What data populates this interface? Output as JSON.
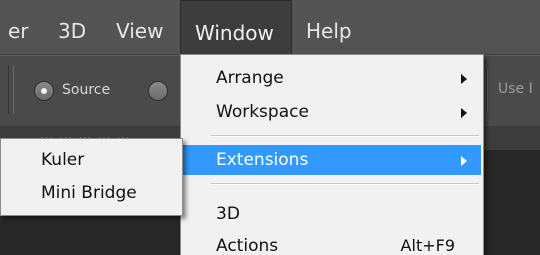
{
  "menubar": {
    "items": [
      {
        "id": "filter",
        "label": "er"
      },
      {
        "id": "3d",
        "label": "3D"
      },
      {
        "id": "view",
        "label": "View"
      },
      {
        "id": "window",
        "label": "Window",
        "active": true
      },
      {
        "id": "help",
        "label": "Help"
      }
    ]
  },
  "options_bar": {
    "source_label": "Source",
    "source_selected": true,
    "destination_selected": false,
    "use_label": "Use I"
  },
  "tab_strip": {
    "faded_text": "… … … … …"
  },
  "window_menu": {
    "items": [
      {
        "label": "Arrange",
        "has_submenu": true
      },
      {
        "label": "Workspace",
        "has_submenu": true
      },
      {
        "label": "Extensions",
        "has_submenu": true,
        "highlighted": true
      },
      {
        "label": "3D",
        "has_submenu": false
      },
      {
        "label": "Actions",
        "shortcut": "Alt+F9"
      }
    ]
  },
  "extensions_submenu": {
    "items": [
      {
        "label": "Kuler"
      },
      {
        "label": "Mini Bridge"
      }
    ]
  },
  "colors": {
    "menubar_bg": "#535353",
    "menu_bg": "#f1f1f1",
    "highlight": "#3399ff"
  }
}
